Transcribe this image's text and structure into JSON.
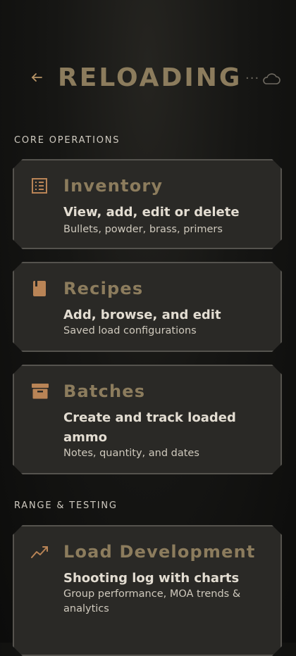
{
  "header": {
    "title": "RELOADING",
    "more_label": "...",
    "back_icon": "arrow-left-icon",
    "sync_icon": "cloud-icon"
  },
  "sections": {
    "core": "CORE OPERATIONS",
    "range": "RANGE & TESTING"
  },
  "cards": {
    "inventory": {
      "title": "Inventory",
      "subtitle": "View, add, edit or delete",
      "description": "Bullets, powder, brass, primers",
      "icon": "list-icon"
    },
    "recipes": {
      "title": "Recipes",
      "subtitle": "Add, browse, and edit",
      "description": "Saved load configurations",
      "icon": "book-icon"
    },
    "batches": {
      "title": "Batches",
      "subtitle": "Create and track loaded ammo",
      "description": "Notes, quantity, and dates",
      "icon": "archive-box-icon"
    },
    "load_development": {
      "title": "Load Development",
      "subtitle": "Shooting log with charts",
      "description": "Group performance, MOA trends & analytics",
      "icon": "trend-chart-icon"
    }
  },
  "colors": {
    "accent": "#b98456",
    "title_gold": "#8c7c5d",
    "card_bg": "#2a2926",
    "card_border": "#55534e"
  }
}
